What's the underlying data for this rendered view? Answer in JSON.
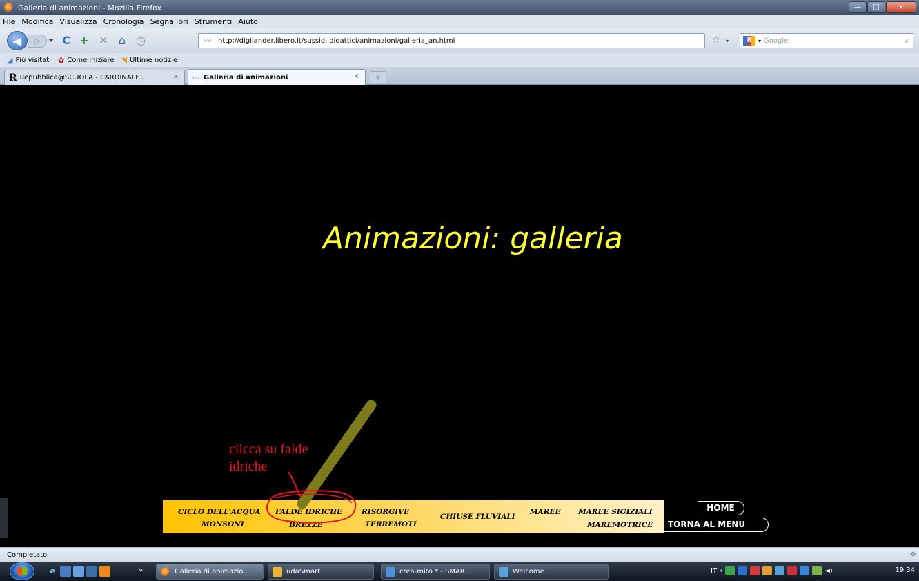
{
  "window": {
    "title": "Galleria di animazioni - Mozilla Firefox",
    "buttons": {
      "minimize": "—",
      "maximize": "□",
      "close": "x"
    }
  },
  "menubar": {
    "items": [
      "File",
      "Modifica",
      "Visualizza",
      "Cronologia",
      "Segnalibri",
      "Strumenti",
      "Aiuto"
    ]
  },
  "navbar": {
    "back_icon": "◀",
    "forward_icon": "▷",
    "reload_icon": "C",
    "add_bookmark_icon": "+",
    "stop_icon": "✕",
    "home_icon": "⌂",
    "history_icon": "◷",
    "site_icon": "〰",
    "url": "http://digilander.libero.it/sussidi.didattici/animazioni/galleria_an.html",
    "star_icon": "☆",
    "search_engine": "8",
    "search_placeholder": "Google",
    "search_icon": "⌕"
  },
  "bookmarks": [
    {
      "label": "Più visitati",
      "icon": "bookmark-visited-icon",
      "glyph": "◢"
    },
    {
      "label": "Come iniziare",
      "icon": "getting-started-icon",
      "glyph": "✿"
    },
    {
      "label": "Ultime notizie",
      "icon": "rss-icon",
      "glyph": "◥"
    }
  ],
  "tabs": [
    {
      "label": "Repubblica@SCUOLA - CARDINALE...",
      "logo": "R",
      "close": "×"
    },
    {
      "label": "Galleria di animazioni",
      "icon": "〰",
      "close": "×",
      "active": true
    }
  ],
  "newtab_icon": "+",
  "page": {
    "title": "Animazioni: galleria",
    "annotation": "clicca su falde idriche",
    "menu_links": [
      "CICLO DELL'ACQUA",
      "FALDE IDRICHE",
      "RISORGIVE",
      "MAREE",
      "MAREE SIGIZIALI",
      "MONSONI",
      "BREZZE",
      "TERREMOTI",
      "CHIUSE FLUVIALI",
      "MAREMOTRICE"
    ],
    "home_label": "HOME",
    "back_menu_label": "TORNA AL MENU",
    "annotation_colors": {
      "arrow": "#7d7b1c",
      "circle": "#e8141b",
      "title": "#ffff33",
      "strip_start": "#ffc300"
    }
  },
  "status": {
    "text": "Completato"
  },
  "taskbar": {
    "more": "»",
    "tasks": [
      {
        "label": "Galleria di animazio..."
      },
      {
        "label": "udaSmart"
      },
      {
        "label": "crea-mito * - SMAR..."
      },
      {
        "label": "Welcome"
      }
    ],
    "lang": "IT",
    "clock": "19.34"
  }
}
